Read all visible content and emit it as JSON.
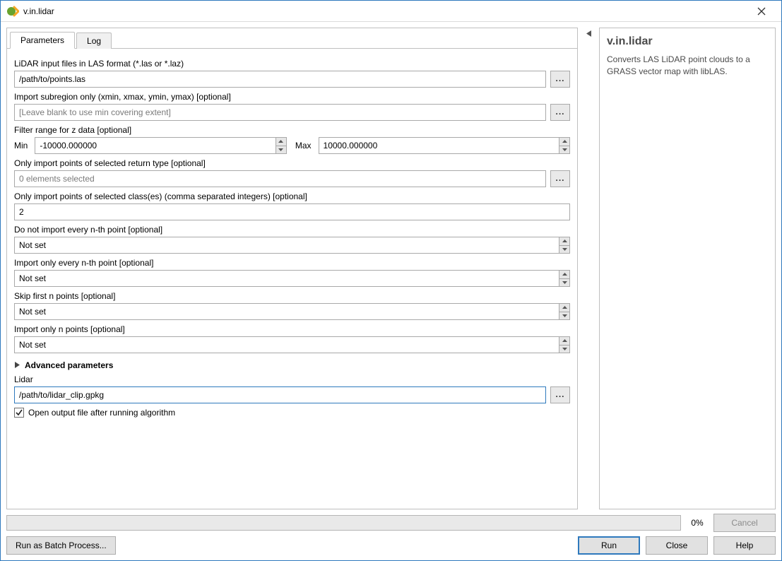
{
  "window": {
    "title": "v.in.lidar"
  },
  "tabs": {
    "parameters": "Parameters",
    "log": "Log"
  },
  "fields": {
    "lidar_input_label": "LiDAR input files in LAS format (*.las or *.laz)",
    "lidar_input_value": "/path/to/points.las",
    "subregion_label": "Import subregion only (xmin, xmax, ymin, ymax) [optional]",
    "subregion_placeholder": "[Leave blank to use min covering extent]",
    "zrange_label": "Filter range for z data [optional]",
    "zrange_min_label": "Min",
    "zrange_min_value": "-10000.000000",
    "zrange_max_label": "Max",
    "zrange_max_value": "10000.000000",
    "return_type_label": "Only import points of selected return type [optional]",
    "return_type_value": "0 elements selected",
    "class_filter_label": "Only import points of selected class(es) (comma separated integers) [optional]",
    "class_filter_value": "2",
    "skip_every_label": "Do not import every n-th point [optional]",
    "import_every_label": "Import only every n-th point [optional]",
    "skip_first_label": "Skip first n points [optional]",
    "import_only_label": "Import only n points [optional]",
    "not_set": "Not set",
    "advanced_label": "Advanced parameters",
    "output_label": "Lidar",
    "output_value": "/path/to/lidar_clip.gpkg",
    "open_output_label": "Open output file after running algorithm"
  },
  "help": {
    "title": "v.in.lidar",
    "text": "Converts LAS LiDAR point clouds to a GRASS vector map with libLAS."
  },
  "progress": {
    "pct": "0%"
  },
  "buttons": {
    "cancel": "Cancel",
    "batch": "Run as Batch Process...",
    "run": "Run",
    "close": "Close",
    "help": "Help",
    "browse": "..."
  }
}
